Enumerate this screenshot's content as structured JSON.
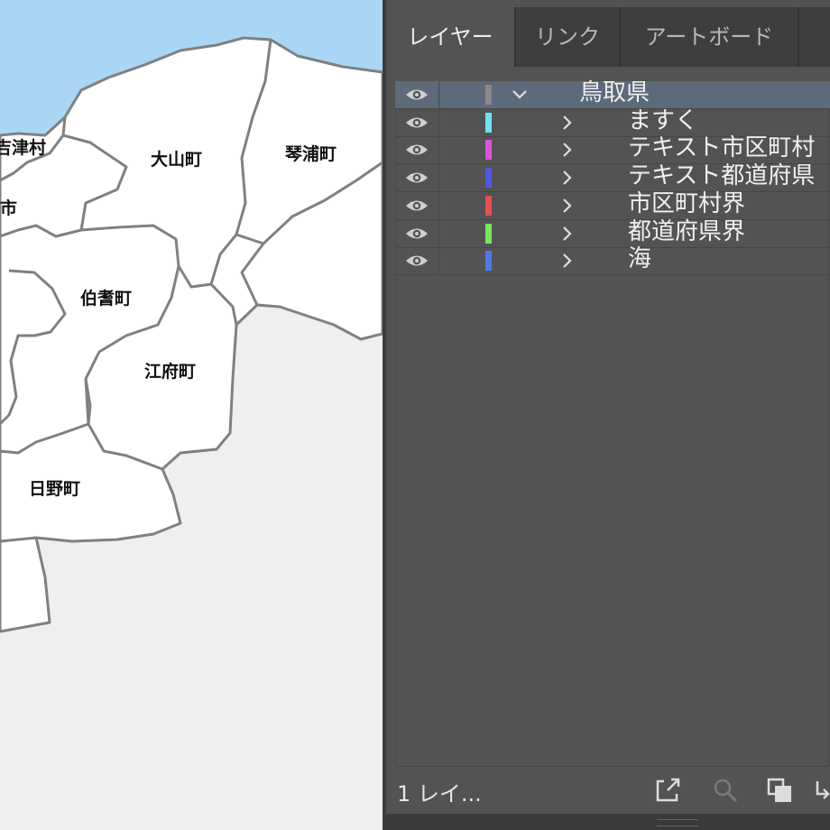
{
  "map": {
    "colors": {
      "sea": "#a9d6f5",
      "land": "#ffffff",
      "border": "#808080",
      "outside": "#efefef"
    },
    "labels": [
      {
        "id": "yonago-village",
        "text": "吉津村"
      },
      {
        "id": "daisen",
        "text": "大山町"
      },
      {
        "id": "kotoura",
        "text": "琴浦町"
      },
      {
        "id": "city",
        "text": "市"
      },
      {
        "id": "hoki",
        "text": "伯耆町"
      },
      {
        "id": "kofu",
        "text": "江府町"
      },
      {
        "id": "hino",
        "text": "日野町"
      }
    ]
  },
  "panel": {
    "tabs": [
      {
        "label": "レイヤー",
        "active": true
      },
      {
        "label": "リンク",
        "active": false
      },
      {
        "label": "アートボード",
        "active": false
      }
    ],
    "layers": [
      {
        "name": "鳥取県",
        "color": "#8a8a8a",
        "expanded": true,
        "selected": true,
        "visible": true
      },
      {
        "name": "ますく",
        "color": "#6ee6ee",
        "expanded": false,
        "selected": false,
        "visible": true
      },
      {
        "name": "テキスト市区町村",
        "color": "#e050e0",
        "expanded": false,
        "selected": false,
        "visible": true
      },
      {
        "name": "テキスト都道府県",
        "color": "#5058e8",
        "expanded": false,
        "selected": false,
        "visible": true
      },
      {
        "name": "市区町村界",
        "color": "#e85050",
        "expanded": false,
        "selected": false,
        "visible": true
      },
      {
        "name": "都道府県界",
        "color": "#78e85a",
        "expanded": false,
        "selected": false,
        "visible": true
      },
      {
        "name": "海",
        "color": "#5078e8",
        "expanded": false,
        "selected": false,
        "visible": true
      }
    ],
    "footer": {
      "count_label": "1 レイ...",
      "icons": [
        "export-icon",
        "search-icon",
        "collect-icon",
        "move-icon"
      ]
    }
  }
}
